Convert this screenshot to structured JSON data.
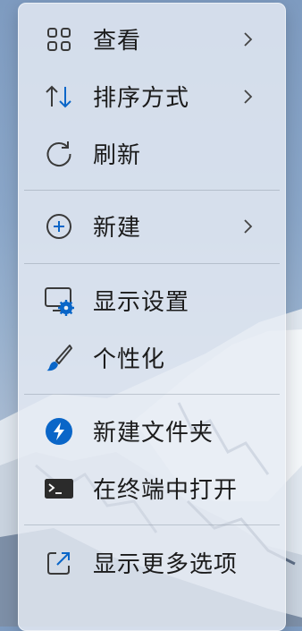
{
  "menu": {
    "items": [
      {
        "label": "查看",
        "icon": "grid-icon",
        "has_submenu": true
      },
      {
        "label": "排序方式",
        "icon": "sort-icon",
        "has_submenu": true
      },
      {
        "label": "刷新",
        "icon": "refresh-icon",
        "has_submenu": false
      },
      {
        "label": "新建",
        "icon": "plus-circle-icon",
        "has_submenu": true
      },
      {
        "label": "显示设置",
        "icon": "display-settings-icon",
        "has_submenu": false
      },
      {
        "label": "个性化",
        "icon": "brush-icon",
        "has_submenu": false
      },
      {
        "label": "新建文件夹",
        "icon": "new-folder-icon",
        "has_submenu": false
      },
      {
        "label": "在终端中打开",
        "icon": "terminal-icon",
        "has_submenu": false
      },
      {
        "label": "显示更多选项",
        "icon": "share-icon",
        "has_submenu": false
      }
    ]
  },
  "colors": {
    "accent": "#0a66c8",
    "text": "#1b1b1b",
    "icon": "#3a3a3a"
  }
}
